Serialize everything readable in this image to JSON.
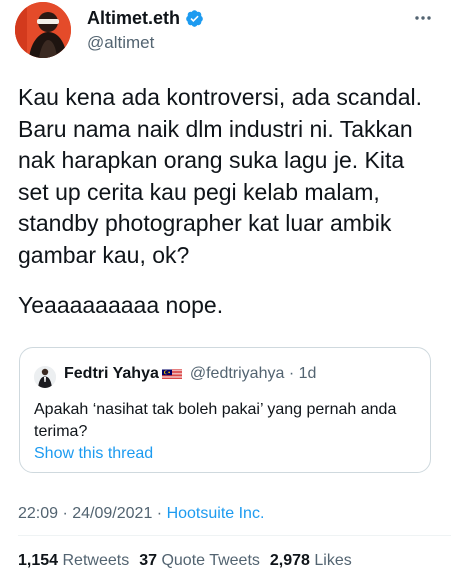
{
  "author": {
    "display_name": "Altimet.eth",
    "handle": "@altimet"
  },
  "tweet": {
    "text": "Kau kena ada kontroversi, ada scandal. Baru nama naik dlm industri ni. Takkan nak harapkan orang suka lagu je. Kita set up cerita kau pegi kelab malam, standby photographer kat luar ambik gambar kau, ok?",
    "text2": "Yeaaaaaaaaa nope."
  },
  "quote": {
    "name": "Fedtri Yahya",
    "handle_time": "@fedtriyahya · 1d",
    "text": "Apakah ‘nasihat tak boleh pakai’ yang pernah anda terima?",
    "link": "Show this thread"
  },
  "meta": {
    "time_date": "22:09 · 24/09/2021 · ",
    "source": "Hootsuite Inc."
  },
  "stats": {
    "retweets_count": "1,154",
    "retweets_label": "Retweets",
    "quotes_count": "37",
    "quotes_label": "Quote Tweets",
    "likes_count": "2,978",
    "likes_label": "Likes"
  },
  "colors": {
    "accent": "#1d9bf0",
    "secondary_text": "#536471",
    "avatar_bg": "#e44b2a"
  },
  "icons": [
    "verified-badge-icon",
    "more-options-icon",
    "malaysia-flag-icon"
  ]
}
